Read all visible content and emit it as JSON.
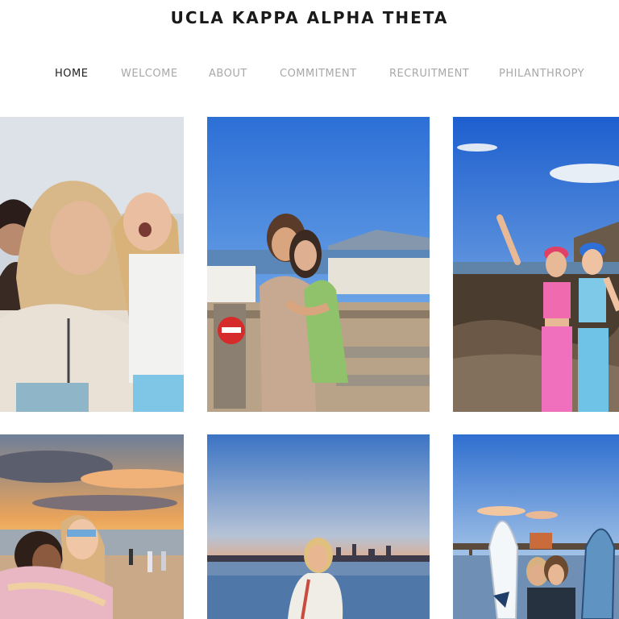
{
  "site": {
    "title": "UCLA KAPPA ALPHA THETA"
  },
  "nav": {
    "items": [
      "HOME",
      "WELCOME",
      "ABOUT",
      "COMMITMENT",
      "RECRUITMENT",
      "PHILANTHROPY"
    ],
    "active": "HOME"
  },
  "gallery": {
    "photos": [
      {
        "subject": "friends-selfie-cloudy-sky"
      },
      {
        "subject": "two-friends-hugging-coastal-view"
      },
      {
        "subject": "friends-on-rocks-by-the-sea"
      },
      {
        "subject": "friends-hugging-on-beach-at-sunset"
      },
      {
        "subject": "woman-on-beach-at-dusk"
      },
      {
        "subject": "friends-with-surfboards-at-pier"
      }
    ]
  },
  "colors": {
    "title": "#1a1a1a",
    "nav_active": "#222222",
    "nav_inactive": "#a8a8a8",
    "background": "#ffffff"
  }
}
